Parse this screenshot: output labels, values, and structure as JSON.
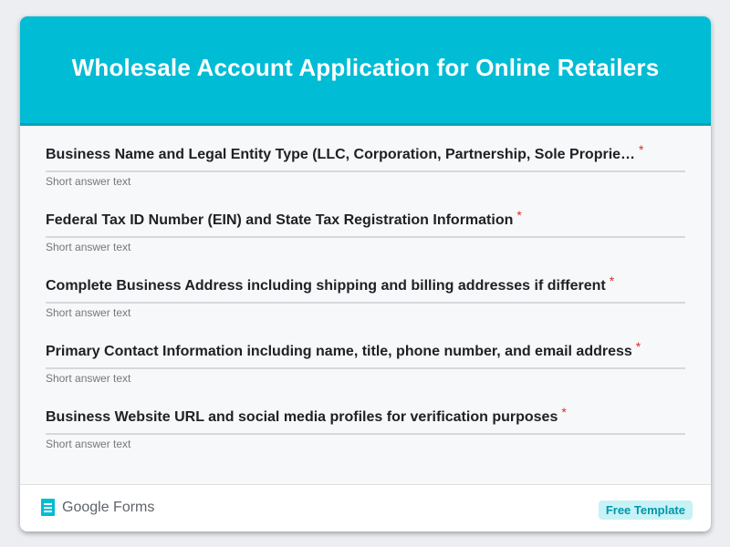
{
  "form": {
    "title": "Wholesale Account Application for Online Retailers",
    "questions": [
      {
        "label": "Business Name and Legal Entity Type (LLC, Corporation, Partnership, Sole Proprie…",
        "required": "*",
        "placeholder": "Short answer text"
      },
      {
        "label": "Federal Tax ID Number (EIN) and State Tax Registration Information",
        "required": "*",
        "placeholder": "Short answer text"
      },
      {
        "label": "Complete Business Address including shipping and billing addresses if different",
        "required": "*",
        "placeholder": "Short answer text"
      },
      {
        "label": "Primary Contact Information including name, title, phone number, and email address",
        "required": "*",
        "placeholder": "Short answer text"
      },
      {
        "label": "Business Website URL and social media profiles for verification purposes",
        "required": "*",
        "placeholder": "Short answer text"
      }
    ]
  },
  "footer": {
    "brand": "Google Forms",
    "brand_icon": "google-forms-icon",
    "badge": "Free Template"
  },
  "colors": {
    "header": "#00bcd4",
    "required": "#d93025",
    "badge_bg": "#c7f2f7",
    "badge_text": "#0097a7"
  }
}
